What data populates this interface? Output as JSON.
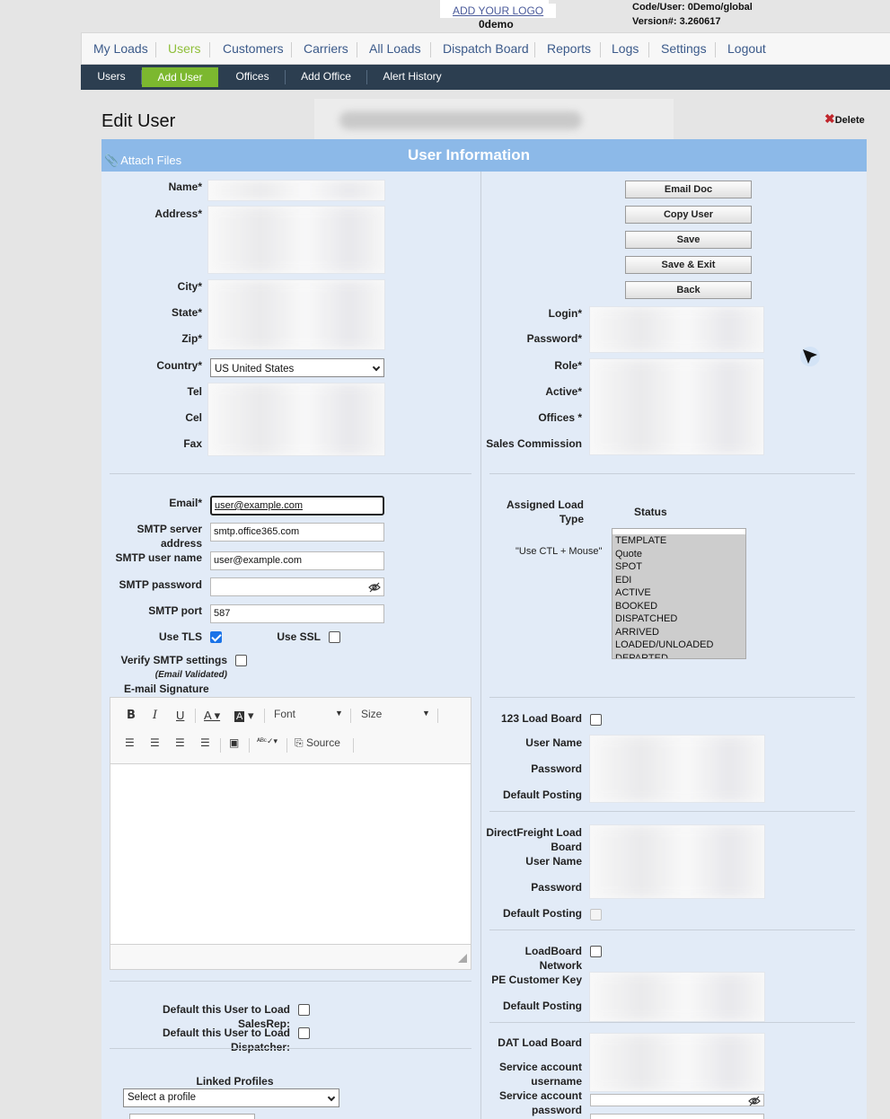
{
  "top": {
    "logo_link": "ADD YOUR LOGO",
    "company": "0demo",
    "code_user": "Code/User: 0Demo/global",
    "version": "Version#: 3.260617"
  },
  "nav": {
    "items": [
      "My Loads",
      "Users",
      "Customers",
      "Carriers",
      "All Loads",
      "Dispatch Board",
      "Reports",
      "Logs",
      "Settings",
      "Logout"
    ],
    "active": "Users"
  },
  "subnav": {
    "items": [
      "Users",
      "Add User",
      "Offices",
      "Add Office",
      "Alert History"
    ],
    "active": "Add User"
  },
  "page": {
    "title": "Edit User",
    "delete_label": "Delete",
    "attach_label": "Attach Files",
    "section_title": "User Information"
  },
  "left": {
    "name": "Name*",
    "address": "Address*",
    "city": "City*",
    "state": "State*",
    "zip": "Zip*",
    "country": "Country*",
    "country_value": "US United States",
    "tel": "Tel",
    "cel": "Cel",
    "fax": "Fax",
    "email": "Email*",
    "email_value": "user@example.com",
    "smtp_server_1": "SMTP server",
    "smtp_server_2": "address",
    "smtp_server_value": "smtp.office365.com",
    "smtp_user": "SMTP user name",
    "smtp_user_value": "user@example.com",
    "smtp_password": "SMTP password",
    "smtp_port": "SMTP port",
    "smtp_port_value": "587",
    "use_tls": "Use TLS",
    "use_ssl": "Use SSL",
    "verify_smtp": "Verify SMTP settings",
    "email_validated": "(Email Validated)",
    "signature": "E-mail Signature",
    "default_salesrep": "Default this User to Load SalesRep:",
    "default_dispatcher": "Default this User to Load Dispatcher:",
    "linked_profiles": "Linked Profiles",
    "linked_select": "Select a profile"
  },
  "editor": {
    "font": "Font",
    "size": "Size",
    "source": "Source"
  },
  "right": {
    "buttons": [
      "Email Doc",
      "Copy User",
      "Save",
      "Save & Exit",
      "Back"
    ],
    "login": "Login*",
    "password": "Password*",
    "role": "Role*",
    "active": "Active*",
    "offices": "Offices *",
    "sales_commission": "Sales Commission",
    "assigned_1": "Assigned Load",
    "assigned_2": "Type",
    "status": "Status",
    "use_ctl": "\"Use CTL + Mouse\"",
    "statuses": [
      "TEMPLATE",
      "Quote",
      "SPOT",
      "EDI",
      "ACTIVE",
      "BOOKED",
      "DISPATCHED",
      "ARRIVED",
      "LOADED/UNLOADED",
      "DEPARTED"
    ],
    "lb123": "123 Load Board",
    "user_name": "User Name",
    "password_plain": "Password",
    "default_posting": "Default Posting",
    "df_1": "DirectFreight Load",
    "df_2": "Board",
    "lbn_1": "LoadBoard",
    "lbn_2": "Network",
    "pe_key": "PE Customer Key",
    "dat": "DAT Load Board",
    "svc_user_1": "Service account",
    "svc_user_2": "username",
    "svc_pw_1": "Service account",
    "svc_pw_2": "password"
  }
}
